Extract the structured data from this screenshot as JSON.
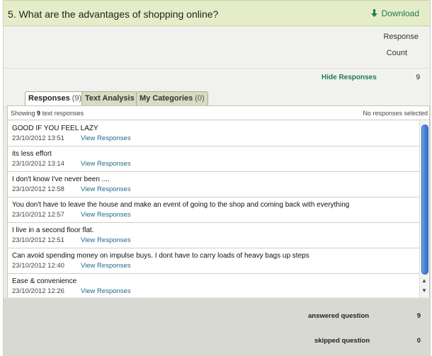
{
  "question": {
    "title": "5. What are the advantages of shopping online?",
    "download_label": "Download",
    "download_icon": "download-arrow-icon",
    "accent_color": "#1c7a5a"
  },
  "response_header": {
    "line1": "Response",
    "line2": "Count"
  },
  "hide_row": {
    "link_label": "Hide Responses",
    "count": "9"
  },
  "tabs": [
    {
      "label": "Responses",
      "count": "(9)",
      "active": true
    },
    {
      "label": "Text Analysis",
      "count": "",
      "active": false
    },
    {
      "label": "My Categories",
      "count": "(0)",
      "active": false
    }
  ],
  "panel": {
    "showing_prefix": "Showing",
    "showing_count": "9",
    "showing_suffix": "text responses",
    "selection_status": "No responses selected"
  },
  "responses": [
    {
      "text": "GOOD IF YOU FEEL LAZY",
      "date": "23/10/2012 13:51",
      "link": "View Responses"
    },
    {
      "text": "its less effort",
      "date": "23/10/2012 13:14",
      "link": "View Responses"
    },
    {
      "text": "I don't know I've never been ....",
      "date": "23/10/2012 12:58",
      "link": "View Responses"
    },
    {
      "text": "You don't have to leave the house and make an event of going to the shop and coming back with everything",
      "date": "23/10/2012 12:57",
      "link": "View Responses"
    },
    {
      "text": "I live in a second floor flat.",
      "date": "23/10/2012 12:51",
      "link": "View Responses"
    },
    {
      "text": "Can avoid spending money on impulse buys. I dont have to carry loads of heavy bags up steps",
      "date": "23/10/2012 12:40",
      "link": "View Responses"
    },
    {
      "text": "Ease & convenience",
      "date": "23/10/2012 12:26",
      "link": "View Responses"
    }
  ],
  "stats": {
    "answered_label": "answered question",
    "answered_value": "9",
    "skipped_label": "skipped question",
    "skipped_value": "0"
  }
}
